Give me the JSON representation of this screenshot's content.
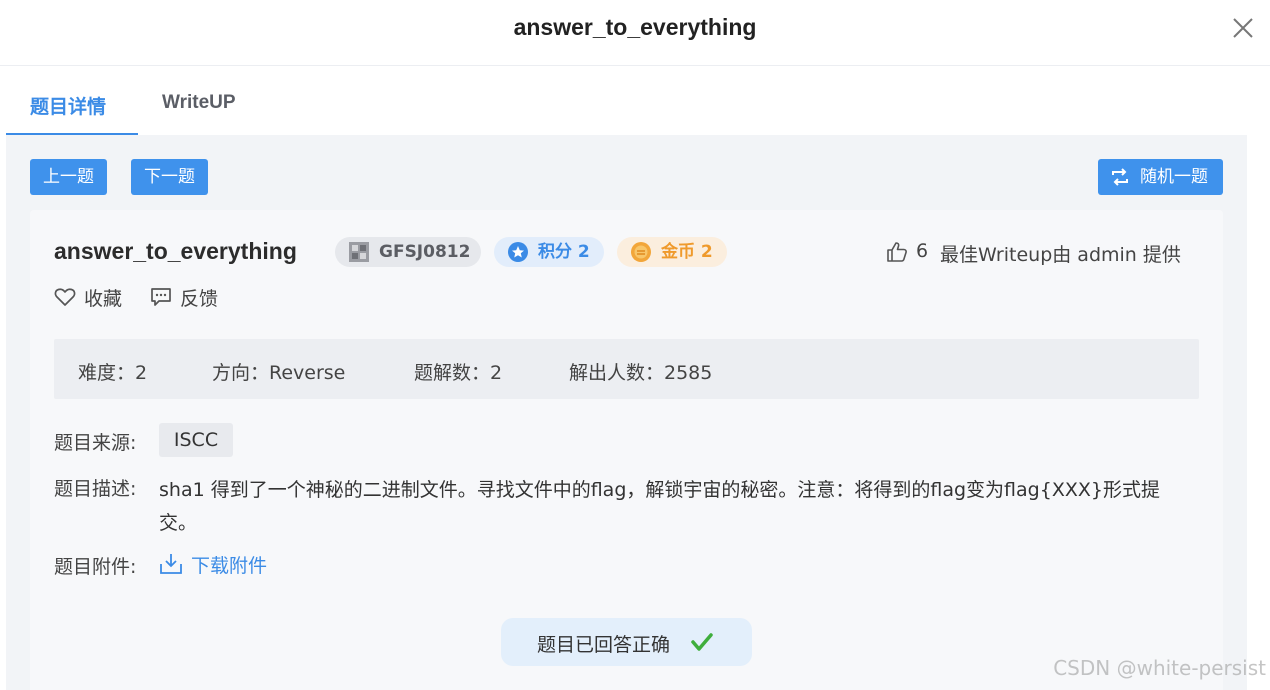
{
  "header": {
    "title": "answer_to_everything"
  },
  "tabs": [
    {
      "label": "题目详情",
      "active": true
    },
    {
      "label": "WriteUP",
      "active": false
    }
  ],
  "nav": {
    "prev_label": "上一题",
    "next_label": "下一题",
    "random_label": "随机一题"
  },
  "challenge": {
    "title": "answer_to_everything",
    "id_badge": "GFSJ0812",
    "score_badge": "积分 2",
    "coin_badge": "金币 2",
    "likes": "6",
    "best_writeup": "最佳Writeup由 admin 提供",
    "favorite_label": "收藏",
    "feedback_label": "反馈"
  },
  "stats": {
    "difficulty": "难度：2",
    "direction": "方向：Reverse",
    "solves": "题解数：2",
    "solvers": "解出人数：2585"
  },
  "details": {
    "source_label": "题目来源:",
    "source_value": "ISCC",
    "desc_label": "题目描述:",
    "desc_value": "sha1 得到了一个神秘的二进制文件。寻找文件中的flag，解锁宇宙的秘密。注意：将得到的flag变为flag{XXX}形式提交。",
    "attach_label": "题目附件:",
    "attach_link": "下载附件"
  },
  "status": {
    "answered": "题目已回答正确"
  },
  "watermark": "CSDN @white-persist",
  "colors": {
    "accent": "#3b8be6",
    "coin": "#ef9a2c",
    "success": "#3fae3c"
  }
}
